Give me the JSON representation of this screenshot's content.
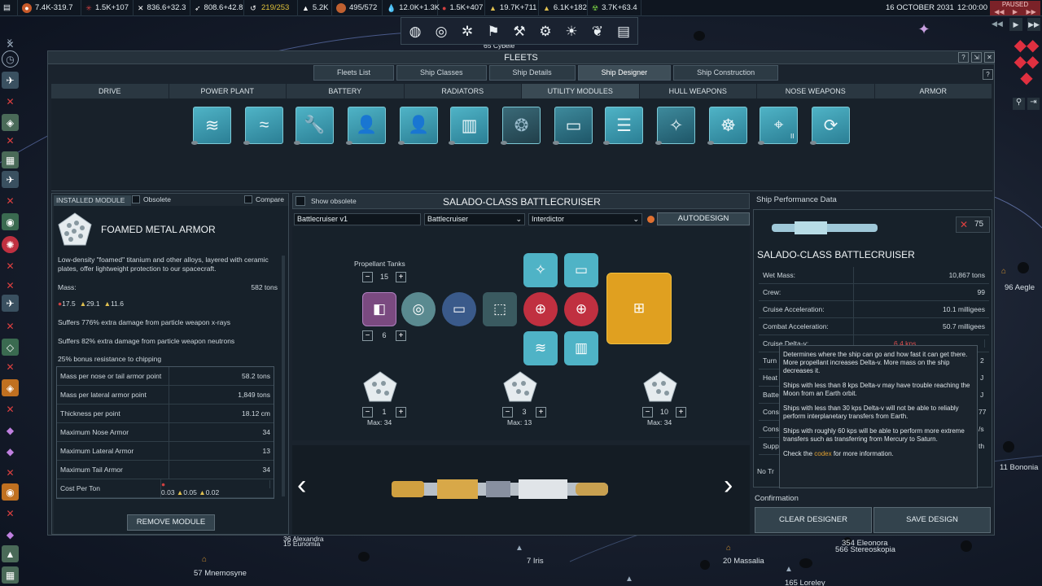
{
  "topbar": {
    "resources": [
      {
        "icon": "globe-icon",
        "color": "#c85a2a",
        "text": "7.4K-319.7"
      },
      {
        "icon": "research-icon",
        "color": "#d04040",
        "text": "1.5K+107"
      },
      {
        "icon": "military-icon",
        "color": "#d0c0a0",
        "text": "836.6+32.3"
      },
      {
        "icon": "boost-icon",
        "color": "#e0e0e0",
        "text": "808.6+42.8"
      },
      {
        "icon": "mission-icon",
        "color": "#e0e0e0",
        "text": "219/253",
        "warn": true
      },
      {
        "icon": "control-icon",
        "color": "#c0c8d0",
        "text": "5.2K"
      },
      {
        "icon": "orbit-icon",
        "color": "#c06030",
        "text": "495/572"
      },
      {
        "icon": "water-icon",
        "color": "#4aa0e0",
        "text": "12.0K+1.3K"
      },
      {
        "icon": "volatiles-icon",
        "color": "#d04040",
        "text": "1.5K+407"
      },
      {
        "icon": "metals-icon",
        "color": "#e0c050",
        "text": "19.7K+711"
      },
      {
        "icon": "noble-metals-icon",
        "color": "#e0c050",
        "text": "6.1K+182"
      },
      {
        "icon": "fissiles-icon",
        "color": "#70c040",
        "text": "3.7K+63.4"
      }
    ],
    "date": "16 OCTOBER 2031",
    "time": "12:00:00",
    "paused": "PAUSED"
  },
  "map": {
    "labels": [
      "65 Cybele",
      "96 Aegle",
      "11 Bononia",
      "36 Alexandra",
      "15 Eunomia",
      "57 Mnemosyne",
      "7 Iris",
      "20 Massalia",
      "354 Eleonora",
      "566 Stereoskopia",
      "165 Loreley"
    ]
  },
  "window": {
    "title": "FLEETS",
    "tabs": [
      "Fleets List",
      "Ship Classes",
      "Ship Details",
      "Ship Designer",
      "Ship Construction"
    ],
    "categories": [
      "DRIVE",
      "POWER PLANT",
      "BATTERY",
      "RADIATORS",
      "UTILITY MODULES",
      "HULL WEAPONS",
      "NOSE WEAPONS",
      "ARMOR"
    ],
    "modules": [
      "water-tank-icon",
      "propellant-tank-icon",
      "repair-icon",
      "officer-icon",
      "admiral-icon",
      "cylinder-icon",
      "drone-icon",
      "water-module-icon",
      "ladder-icon",
      "sensor-icon",
      "helm-icon",
      "targeting-computer-icon",
      "recycler-icon"
    ],
    "module_badge": "II"
  },
  "installed": {
    "tab": "INSTALLED MODULE",
    "obsolete": "Obsolete",
    "compare": "Compare",
    "name": "FOAMED METAL ARMOR",
    "desc": "Low-density \"foamed\" titanium and other alloys, layered with ceramic plates, offer lightweight protection to our spacecraft.",
    "mass_label": "Mass:",
    "mass_value": "582 tons",
    "costs": [
      "17.5",
      "29.1",
      "11.6"
    ],
    "line1": "Suffers 776% extra damage from particle weapon x-rays",
    "line2": "Suffers 82% extra damage from particle weapon neutrons",
    "line3": "25% bonus resistance to chipping",
    "rows": [
      [
        "Mass per nose or tail armor point",
        "58.2 tons"
      ],
      [
        "Mass per lateral armor point",
        "1,849 tons"
      ],
      [
        "Thickness per point",
        "18.12 cm"
      ],
      [
        "Maximum Nose Armor",
        "34"
      ],
      [
        "Maximum Lateral Armor",
        "13"
      ],
      [
        "Maximum Tail Armor",
        "34"
      ]
    ],
    "cost_label": "Cost Per Ton",
    "cost_values": [
      "0.03",
      "0.05",
      "0.02"
    ],
    "remove": "REMOVE MODULE"
  },
  "designer": {
    "show_obsolete": "Show obsolete",
    "title": "SALADO-CLASS BATTLECRUISER",
    "name_field": "Battlecruiser v1",
    "hull": "Battlecruiser",
    "role": "Interdictor",
    "autodesign": "AUTODESIGN",
    "propellant_label": "Propellant Tanks",
    "propellant": "15",
    "drive_count": "6",
    "armor": [
      {
        "value": "1",
        "max": "Max: 34"
      },
      {
        "value": "3",
        "max": "Max: 13"
      },
      {
        "value": "10",
        "max": "Max: 34"
      }
    ]
  },
  "performance": {
    "title": "Ship Performance Data",
    "badge": "75",
    "ship": "SALADO-CLASS BATTLECRUISER",
    "rows": [
      [
        "Wet Mass:",
        "10,867 tons"
      ],
      [
        "Crew:",
        "99"
      ],
      [
        "Cruise Acceleration:",
        "10.1 milligees"
      ],
      [
        "Combat Acceleration:",
        "50.7 milligees"
      ],
      [
        "Cruise Delta-v:",
        "6.4 kps"
      ]
    ],
    "partial": [
      "Turn",
      "Heat",
      "Batte",
      "Cons",
      "Cons",
      "Supp"
    ],
    "partial_right": [
      "2",
      "J",
      "J",
      "77",
      "/s",
      "th"
    ],
    "no_tr": "No Tr",
    "confirmation": "Confirmation",
    "clear": "CLEAR DESIGNER",
    "save": "SAVE DESIGN",
    "delta_color": "#e05050"
  },
  "tooltip": {
    "p1": "Determines where the ship can go and how fast it can get there. More propellant increases Delta-v. More mass on the ship decreases it.",
    "p2": "Ships with less than 8 kps Delta-v may have trouble reaching the Moon from an Earth orbit.",
    "p3": "Ships with less than 30 kps Delta-v will not be able to reliably perform interplanetary transfers from Earth.",
    "p4": "Ships with roughly 60 kps will be able to perform more extreme transfers such as transferring from Mercury to Saturn.",
    "p5_pre": "Check the ",
    "p5_link": "codex",
    "p5_post": " for more information."
  }
}
